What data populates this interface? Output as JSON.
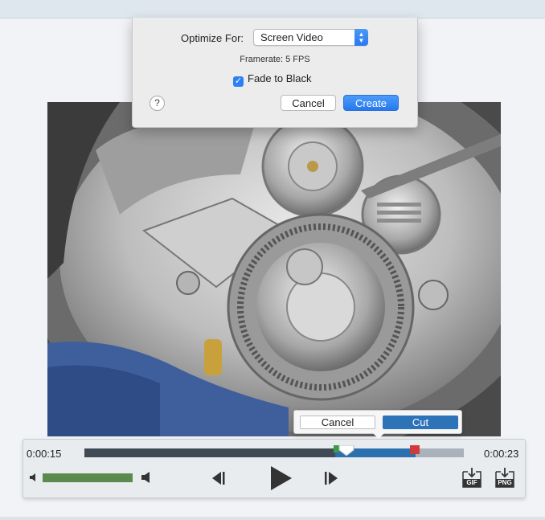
{
  "dialog": {
    "optimize_label": "Optimize For:",
    "optimize_value": "Screen Video",
    "framerate": "Framerate: 5 FPS",
    "fade_label": "Fade to Black",
    "fade_checked": true,
    "help": "?",
    "cancel_label": "Cancel",
    "create_label": "Create"
  },
  "cut_popup": {
    "cancel_label": "Cancel",
    "cut_label": "Cut"
  },
  "player": {
    "time_start": "0:00:15",
    "time_end": "0:00:23",
    "volume_level": 1.0,
    "export_gif": "GIF",
    "export_png": "PNG"
  },
  "colors": {
    "accent_blue": "#2d7ff4",
    "selection_blue": "#2c6fae",
    "start_marker": "#3a9c45",
    "end_marker": "#d23a3a",
    "volume_green": "#5a8a4e"
  }
}
